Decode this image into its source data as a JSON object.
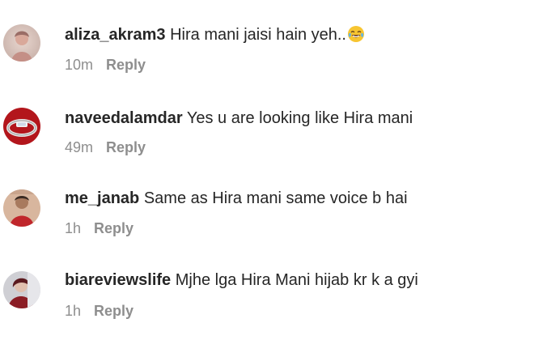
{
  "comments": [
    {
      "avatar_icon": "user-avatar-photo",
      "username": "aliza_akram3",
      "text": "Hira mani jaisi hain yeh..",
      "emoji": "face-with-tears-of-joy",
      "time": "10m",
      "reply_label": "Reply"
    },
    {
      "avatar_icon": "ring-avatar-photo",
      "username": "naveedalamdar",
      "text": "Yes u are looking like Hira mani",
      "time": "49m",
      "reply_label": "Reply"
    },
    {
      "avatar_icon": "user-avatar-photo",
      "username": "me_janab",
      "text": "Same as Hira mani same voice b hai",
      "time": "1h",
      "reply_label": "Reply"
    },
    {
      "avatar_icon": "user-avatar-photo",
      "username": "biareviewslife",
      "text": "Mjhe lga Hira Mani hijab kr k a gyi",
      "time": "1h",
      "reply_label": "Reply"
    }
  ],
  "colors": {
    "text": "#262626",
    "secondary": "#8e8e8e",
    "background": "#ffffff"
  }
}
